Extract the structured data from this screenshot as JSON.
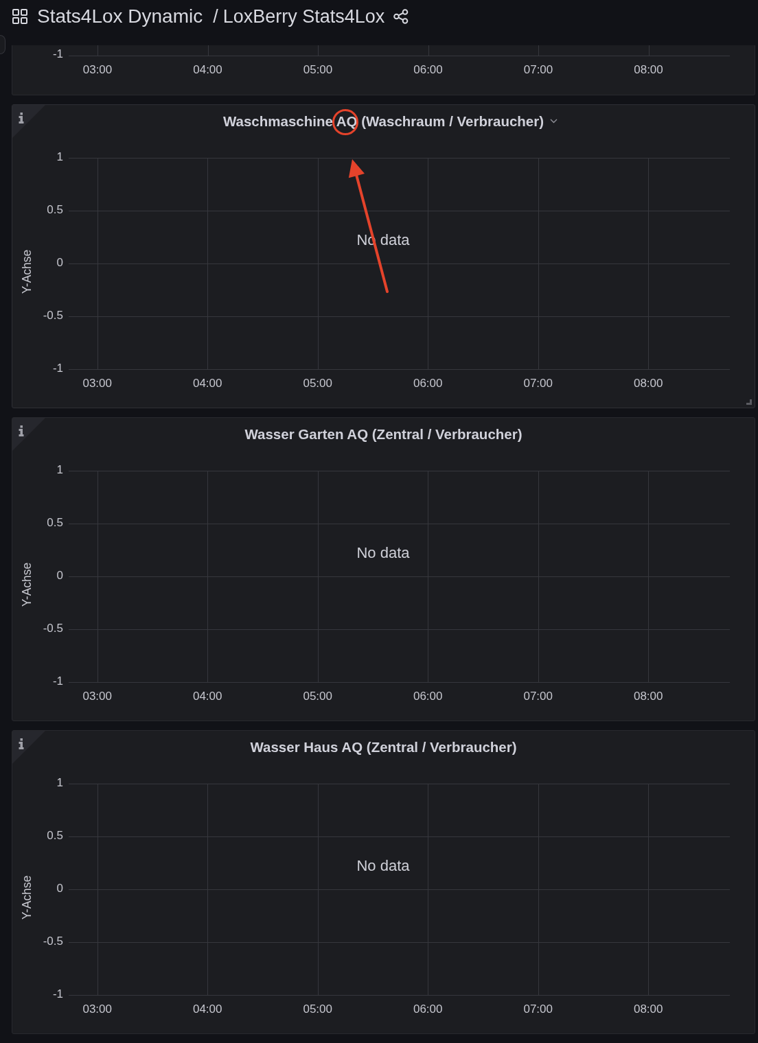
{
  "header": {
    "folder": "Stats4Lox Dynamic",
    "separator": "/",
    "title": "LoxBerry Stats4Lox"
  },
  "panel_fragment": {
    "y_tick_label": "-1",
    "x_tick_labels": [
      "03:00",
      "04:00",
      "05:00",
      "06:00",
      "07:00",
      "08:00"
    ]
  },
  "panels": [
    {
      "title": "Waschmaschine AQ (Waschraum / Verbraucher)",
      "hovered": true,
      "message": "No data",
      "chart_data": {
        "type": "line",
        "ylabel": "Y-Achse",
        "grid": true,
        "ylim": [
          -1,
          1
        ],
        "yticks": [
          1,
          0.5,
          0,
          -0.5,
          -1
        ],
        "xlim": [
          2.74,
          8.74
        ],
        "xticks": [
          {
            "value": 3,
            "label": "03:00"
          },
          {
            "value": 4,
            "label": "04:00"
          },
          {
            "value": 5,
            "label": "05:00"
          },
          {
            "value": 6,
            "label": "06:00"
          },
          {
            "value": 7,
            "label": "07:00"
          },
          {
            "value": 8,
            "label": "08:00"
          }
        ]
      }
    },
    {
      "title": "Wasser Garten AQ (Zentral / Verbraucher)",
      "hovered": false,
      "message": "No data",
      "chart_data": {
        "type": "line",
        "ylabel": "Y-Achse",
        "grid": true,
        "ylim": [
          -1,
          1
        ],
        "yticks": [
          1,
          0.5,
          0,
          -0.5,
          -1
        ],
        "xlim": [
          2.74,
          8.74
        ],
        "xticks": [
          {
            "value": 3,
            "label": "03:00"
          },
          {
            "value": 4,
            "label": "04:00"
          },
          {
            "value": 5,
            "label": "05:00"
          },
          {
            "value": 6,
            "label": "06:00"
          },
          {
            "value": 7,
            "label": "07:00"
          },
          {
            "value": 8,
            "label": "08:00"
          }
        ]
      }
    },
    {
      "title": "Wasser Haus AQ (Zentral / Verbraucher)",
      "hovered": false,
      "message": "No data",
      "chart_data": {
        "type": "line",
        "ylabel": "Y-Achse",
        "grid": true,
        "ylim": [
          -1,
          1
        ],
        "yticks": [
          1,
          0.5,
          0,
          -0.5,
          -1
        ],
        "xlim": [
          2.74,
          8.74
        ],
        "xticks": [
          {
            "value": 3,
            "label": "03:00"
          },
          {
            "value": 4,
            "label": "04:00"
          },
          {
            "value": 5,
            "label": "05:00"
          },
          {
            "value": 6,
            "label": "06:00"
          },
          {
            "value": 7,
            "label": "07:00"
          },
          {
            "value": 8,
            "label": "08:00"
          }
        ]
      }
    }
  ]
}
